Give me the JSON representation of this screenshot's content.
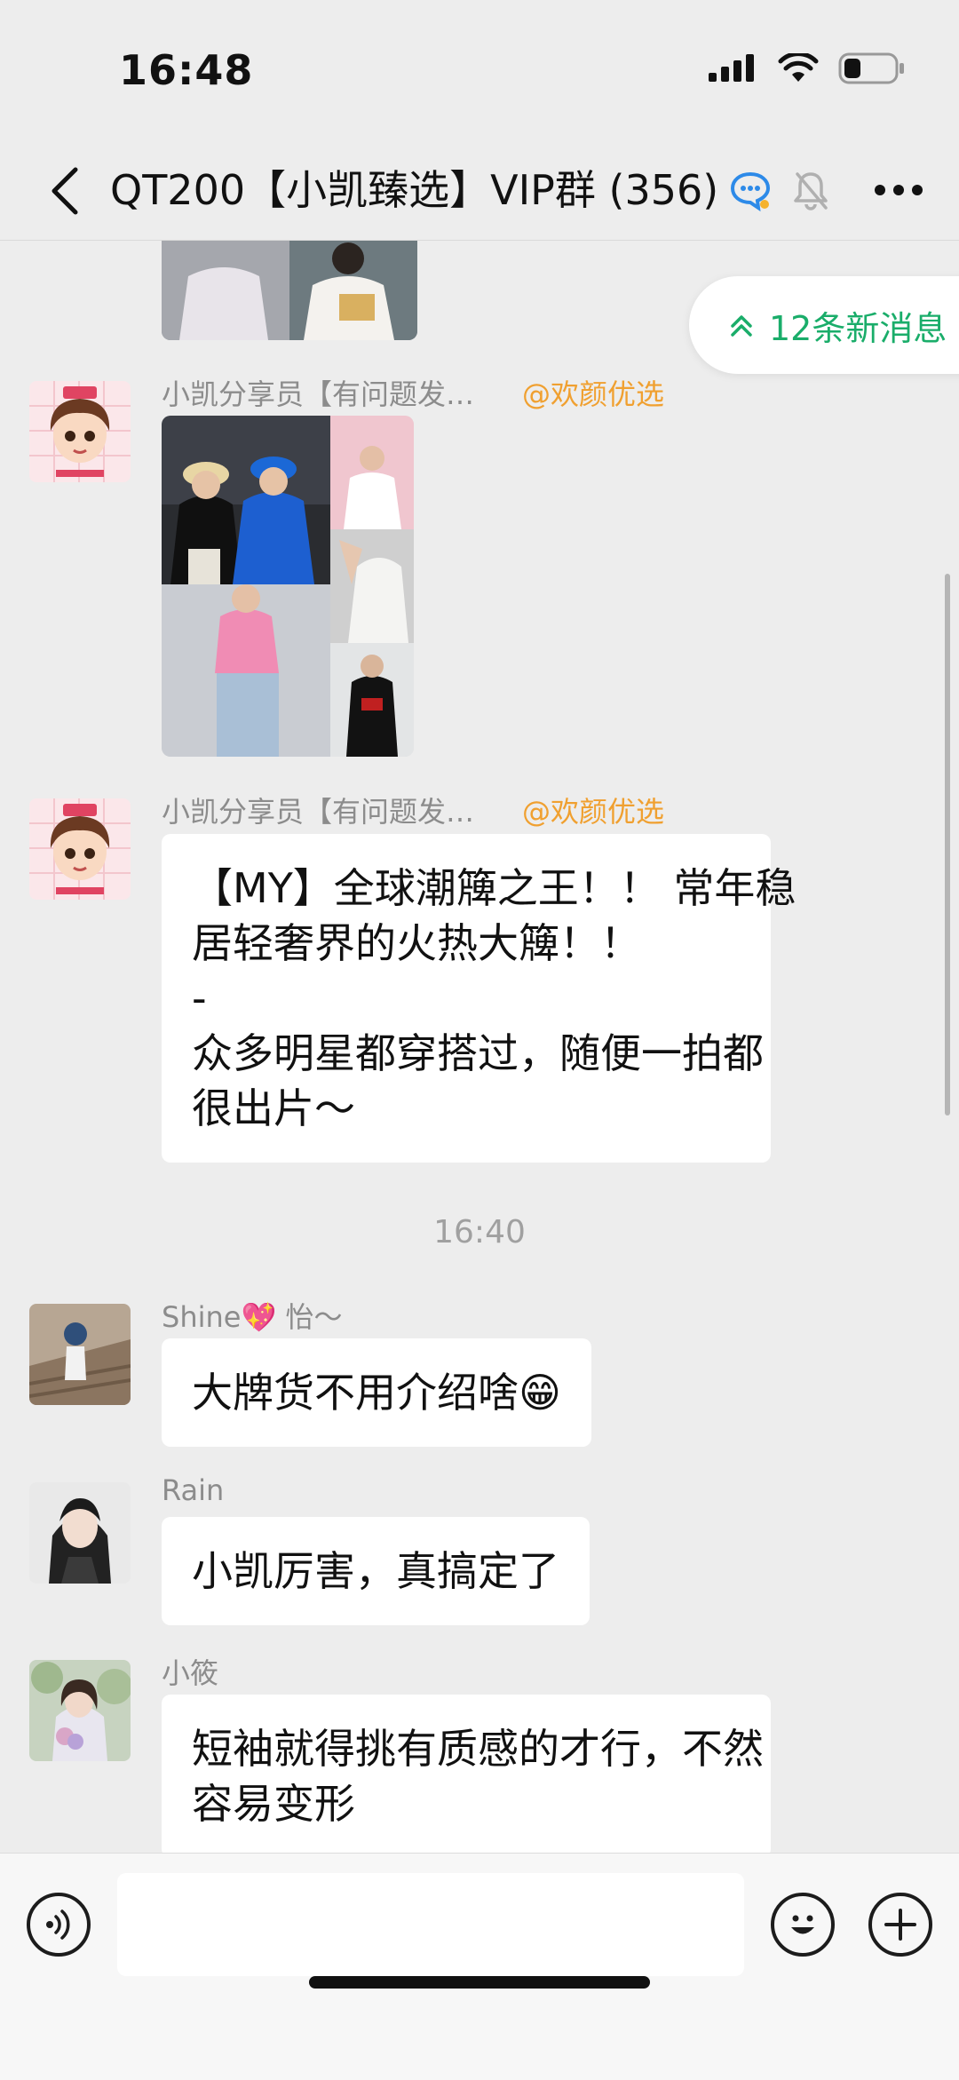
{
  "status_bar": {
    "time": "16:48",
    "icons": [
      "cellular-signal-icon",
      "wifi-icon",
      "battery-icon"
    ]
  },
  "header": {
    "title": "QT200【小凯臻选】VIP群 (356)",
    "icons": [
      "chat-bubble-icon",
      "mute-bell-icon",
      "more-icon"
    ]
  },
  "new_messages_label": "12条新消息",
  "messages": [
    {
      "sender": "小凯分享员【有问题发…",
      "mention": "@欢颜优选",
      "type": "image"
    },
    {
      "sender": "小凯分享员【有问题发…",
      "mention": "@欢颜优选",
      "type": "text",
      "lines": [
        "【MY】全球潮簰之王！！ 常年稳",
        "居轻奢界的火热大簰！！",
        "-",
        "众多明星都穿搭过，随便一拍都",
        "很出片～"
      ]
    },
    {
      "sender": "Shine💖 怡～",
      "type": "text",
      "lines": [
        "大牌货不用介绍啥😁"
      ]
    },
    {
      "sender": "Rain",
      "type": "text",
      "lines": [
        "小凯厉害，真搞定了"
      ]
    },
    {
      "sender": "小筱",
      "type": "text",
      "lines": [
        "短袖就得挑有质感的才行，不然",
        "容易变形"
      ]
    }
  ],
  "timestamp": "16:40",
  "input_bar": {
    "icons": [
      "voice-icon",
      "emoji-icon",
      "plus-icon"
    ]
  },
  "colors": {
    "background": "#ededed",
    "bubble": "#ffffff",
    "accent_green": "#1aad6a",
    "mention_orange": "#f0a030"
  }
}
